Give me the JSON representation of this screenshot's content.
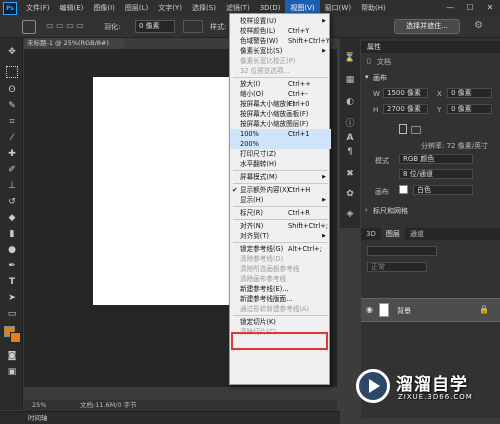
{
  "app": {
    "logo": "Ps"
  },
  "menubar": {
    "items": [
      "文件(F)",
      "编辑(E)",
      "图像(I)",
      "图层(L)",
      "文字(Y)",
      "选择(S)",
      "滤镜(T)",
      "3D(D)",
      "视图(V)",
      "窗口(W)",
      "帮助(H)"
    ],
    "active_index": 8
  },
  "options": {
    "feather_label": "羽化:",
    "feather_value": "0 像素",
    "style_label": "样式:",
    "select_mask": "选择并遮住..."
  },
  "document": {
    "tab": "未标题-1 @ 25%(RGB/8#)"
  },
  "status": {
    "zoom": "25%",
    "doc_info": "文档:11.6M/0 字节"
  },
  "timeline": {
    "label": "时间轴"
  },
  "view_menu": [
    {
      "label": "校样设置(U)",
      "arrow": true
    },
    {
      "label": "校样颜色(L)",
      "shortcut": "Ctrl+Y"
    },
    {
      "label": "色域警告(W)",
      "shortcut": "Shift+Ctrl+Y"
    },
    {
      "label": "像素长宽比(S)",
      "arrow": true
    },
    {
      "label": "像素长宽比校正(P)",
      "disabled": true
    },
    {
      "label": "32 位预览选项...",
      "disabled": true
    },
    {
      "sep": true
    },
    {
      "label": "放大(I)",
      "shortcut": "Ctrl++"
    },
    {
      "label": "缩小(O)",
      "shortcut": "Ctrl+-"
    },
    {
      "label": "按屏幕大小缩放(F)",
      "shortcut": "Ctrl+0"
    },
    {
      "label": "按屏幕大小缩放画板(F)"
    },
    {
      "label": "按屏幕大小缩放图层(F)"
    },
    {
      "label": "100%",
      "shortcut": "Ctrl+1",
      "highlight": true
    },
    {
      "label": "200%",
      "highlight": true
    },
    {
      "label": "打印尺寸(Z)"
    },
    {
      "label": "水平翻转(H)"
    },
    {
      "sep": true
    },
    {
      "label": "屏幕模式(M)",
      "arrow": true
    },
    {
      "sep": true
    },
    {
      "label": "显示额外内容(X)",
      "shortcut": "Ctrl+H",
      "checked": true
    },
    {
      "label": "显示(H)",
      "arrow": true
    },
    {
      "sep": true
    },
    {
      "label": "标尺(R)",
      "shortcut": "Ctrl+R"
    },
    {
      "sep": true
    },
    {
      "label": "对齐(N)",
      "shortcut": "Shift+Ctrl+;"
    },
    {
      "label": "对齐到(T)",
      "arrow": true
    },
    {
      "sep": true
    },
    {
      "label": "锁定参考线(G)",
      "shortcut": "Alt+Ctrl+;"
    },
    {
      "label": "清除参考线(D)",
      "disabled": true
    },
    {
      "label": "清除所选画板参考线",
      "disabled": true
    },
    {
      "label": "清除画布参考线",
      "disabled": true
    },
    {
      "label": "新建参考线(E)..."
    },
    {
      "label": "新建参考线版面..."
    },
    {
      "label": "通过形状新建参考线(A)",
      "disabled": true
    },
    {
      "sep": true
    },
    {
      "label": "锁定切片(K)"
    },
    {
      "label": "清除切片(C)",
      "disabled": true
    }
  ],
  "properties": {
    "title": "属性",
    "doc_label": "文档",
    "canvas_section": "画布",
    "w_label": "W",
    "w_value": "1500 像素",
    "h_label": "H",
    "h_value": "2700 像素",
    "x_label": "X",
    "x_value": "0 像素",
    "y_label": "Y",
    "y_value": "0 像素",
    "resolution": "分辨率: 72 像素/英寸",
    "mode_label": "模式",
    "mode_value": "RGB 颜色",
    "depth_value": "8 位/通道",
    "bg_label": "画布",
    "bg_value": "白色",
    "rulers_section": "标尺和网格"
  },
  "layers": {
    "tabs": [
      "3D",
      "图层",
      "通道"
    ],
    "kind": "正常",
    "layer_name": "背景"
  },
  "watermark": {
    "brand": "溜溜自学",
    "site": "ZIXUE.3D66.COM"
  },
  "colors": {
    "menu_highlight": "#cfe3fb",
    "red_box": "#e23636",
    "foreground": "#e8820c",
    "active_menu": "#1f5fb0"
  }
}
